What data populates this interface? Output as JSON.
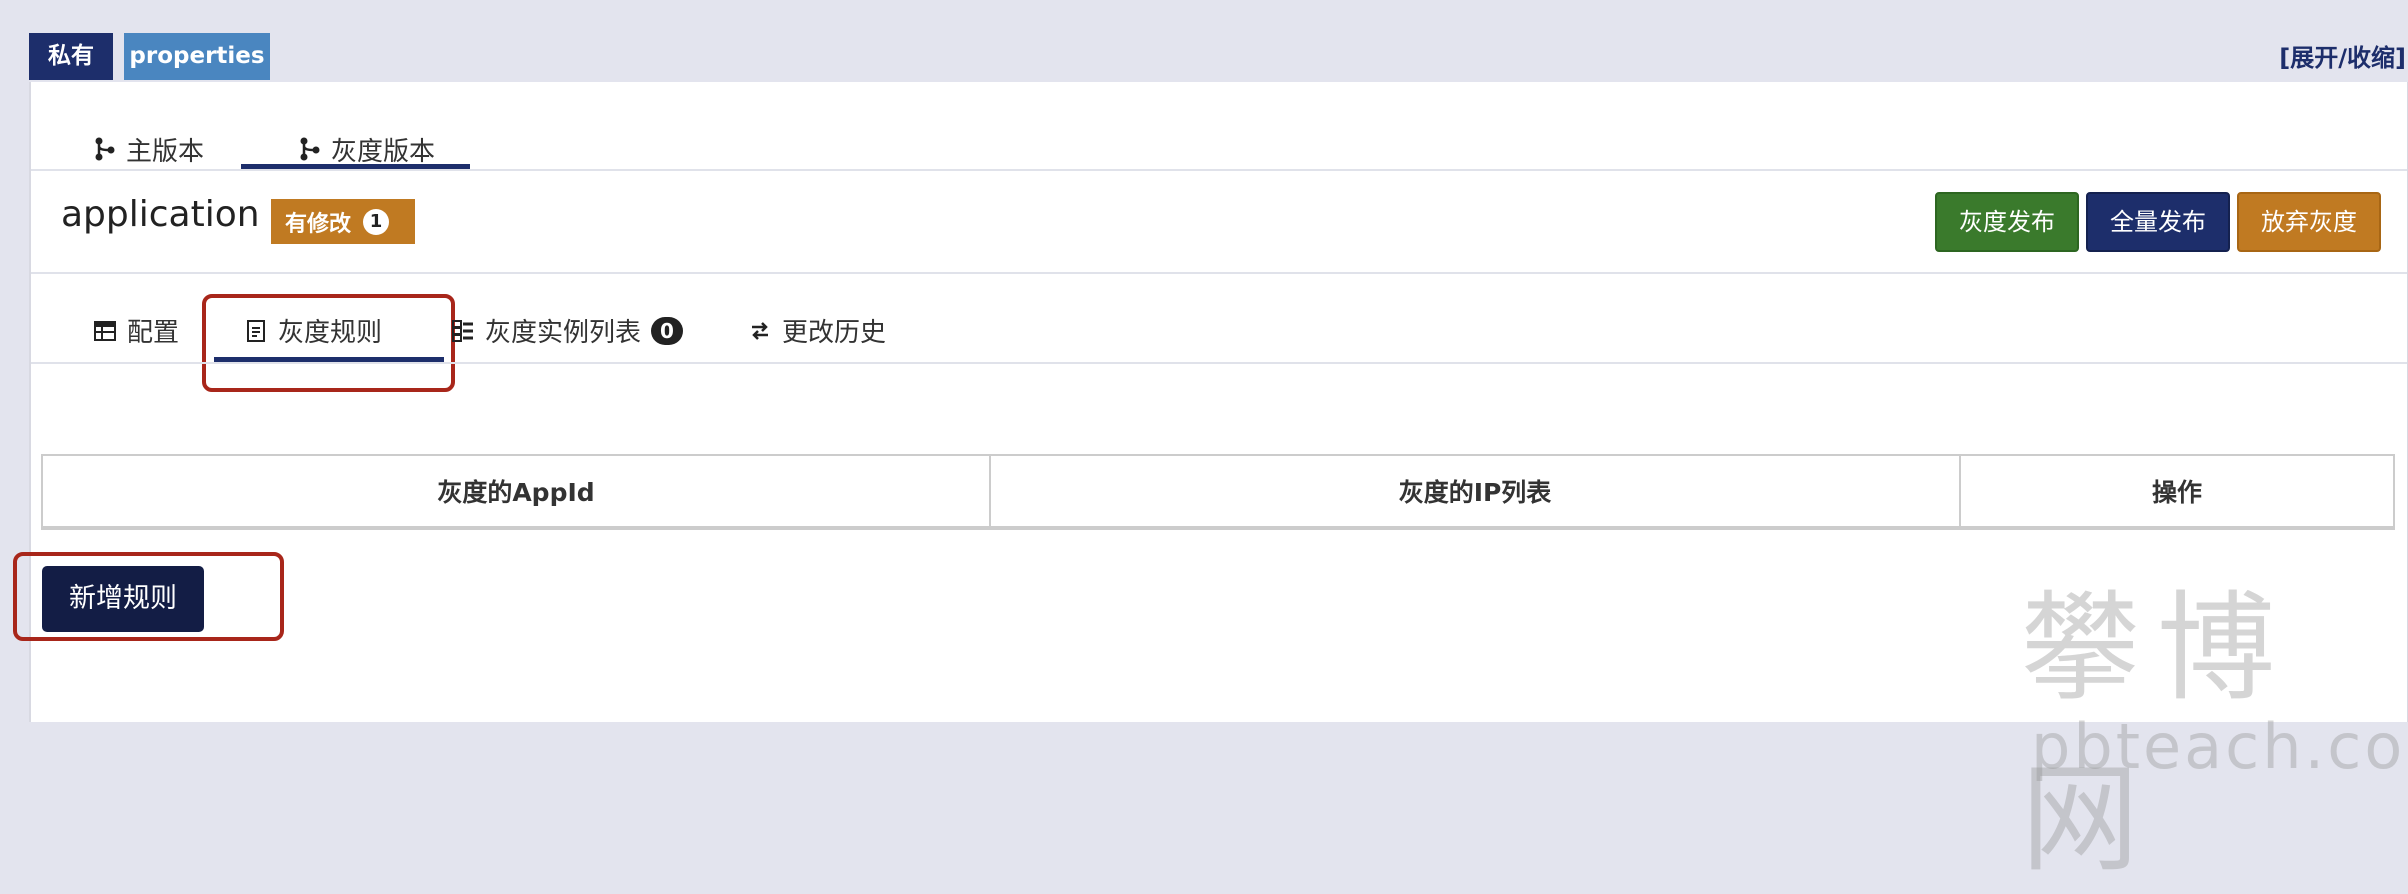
{
  "header": {
    "private_tag": "私有",
    "format_tag": "properties",
    "toggle": "[展开/收缩]"
  },
  "branch_tabs": {
    "main": "主版本",
    "gray": "灰度版本"
  },
  "namespace": {
    "name": "application",
    "modified_label": "有修改",
    "modified_count": "1"
  },
  "actions": {
    "gray_release": "灰度发布",
    "full_release": "全量发布",
    "abandon_gray": "放弃灰度"
  },
  "sub_tabs": {
    "config": "配置",
    "gray_rules": "灰度规则",
    "gray_instances": "灰度实例列表",
    "gray_instances_count": "0",
    "history": "更改历史"
  },
  "rules_table": {
    "columns": [
      "灰度的AppId",
      "灰度的IP列表",
      "操作"
    ]
  },
  "add_rule_button": "新增规则",
  "watermark": {
    "cn": "攀博网",
    "en": "pbteach.com"
  },
  "colors": {
    "navy": "#1d2e6b",
    "green": "#3a7a2c",
    "orange": "#c07a22",
    "highlight_red": "#a8261a"
  }
}
